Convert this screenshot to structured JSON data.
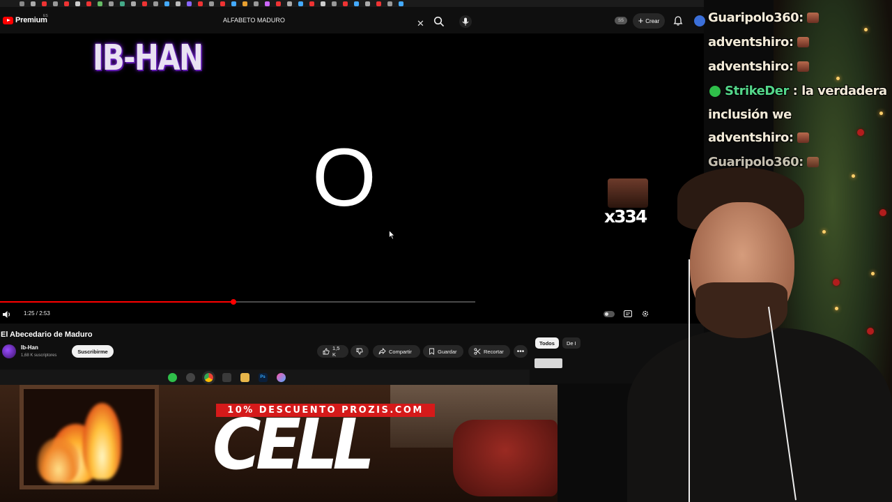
{
  "youtube": {
    "logo_text": "Premium",
    "region": "ES",
    "search": {
      "value": "ALFABETO MADURO"
    },
    "cast_badge": "SS",
    "create_label": "Crear"
  },
  "player": {
    "overlay_channel": "IB-HAN",
    "big_letter": "O",
    "emote_combo_count": "x334",
    "time_display": "1:25 / 2:53",
    "progress_fraction": 0.491
  },
  "video": {
    "title": "El Abecedario de Maduro",
    "channel_name": "Ib-Han",
    "subscribers": "1,68 K suscriptores",
    "subscribe_label": "Suscribirme",
    "like_count": "1,5 K",
    "share_label": "Compartir",
    "save_label": "Guardar",
    "clip_label": "Recortar",
    "more_label": "•••",
    "chips": [
      "Todos",
      "De I"
    ]
  },
  "taskbar": {
    "icons": [
      "whatsapp-icon",
      "clock-icon",
      "chrome-icon",
      "tool-icon",
      "folder-icon",
      "photoshop-icon",
      "app-icon"
    ],
    "photoshop_label": "Ps"
  },
  "sponsor": {
    "banner": "10% DESCUENTO PROZIS.COM",
    "big_text": "CELL"
  },
  "chat": {
    "messages": [
      {
        "user": "Guaripolo360",
        "separator": " :"
      },
      {
        "user": "adventshiro",
        "separator": " :"
      },
      {
        "user": "adventshiro",
        "separator": " :"
      },
      {
        "user": "StrikeDer",
        "separator": " : ",
        "text": "la verdadera",
        "text_cont": "inclusión we"
      },
      {
        "user": "adventshiro",
        "separator": " :"
      },
      {
        "user": "Guaripolo360",
        "separator": " :"
      }
    ]
  },
  "colors": {
    "youtube_red": "#ff0000",
    "promo_red": "#d51a1a",
    "chat_text": "#f2ead8",
    "chat_user_green": "#54d68a"
  }
}
